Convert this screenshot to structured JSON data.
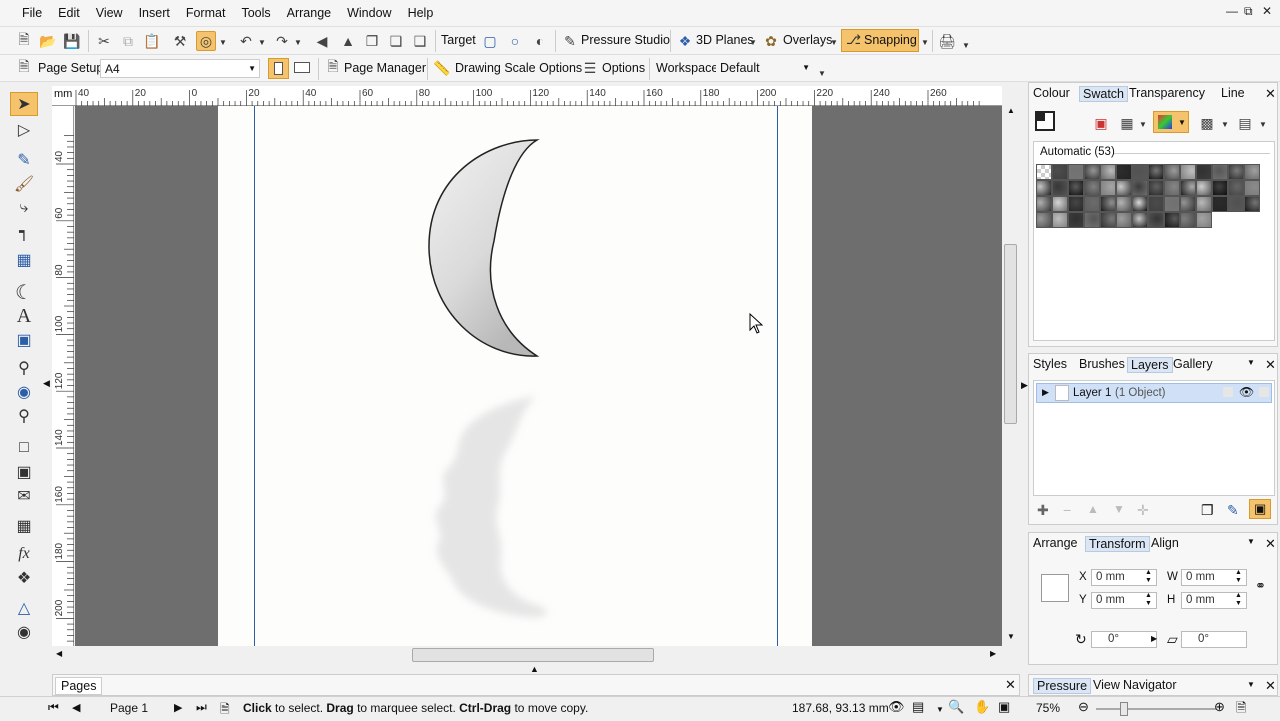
{
  "menu": [
    "File",
    "Edit",
    "View",
    "Insert",
    "Format",
    "Tools",
    "Arrange",
    "Window",
    "Help"
  ],
  "toolbar1": {
    "target_label": "Target",
    "pressure_label": "Pressure Studio",
    "planes_label": "3D Planes",
    "overlays_label": "Overlays",
    "snapping_label": "Snapping"
  },
  "toolbar2": {
    "page_setup_label": "Page Setup",
    "page_size_value": "A4",
    "page_manager_label": "Page Manager",
    "drawing_scale_label": "Drawing Scale Options",
    "options_label": "Options",
    "workspace_label": "Workspace",
    "workspace_value": "Default"
  },
  "ruler": {
    "unit": "mm",
    "h_ticks": [
      "40",
      "20",
      "0",
      "20",
      "40",
      "60",
      "80",
      "100",
      "120",
      "140",
      "160",
      "180",
      "200",
      "220",
      "240",
      "260"
    ],
    "v_ticks": [
      "40",
      "60",
      "80",
      "100",
      "120",
      "140",
      "160",
      "180",
      "200"
    ]
  },
  "colour_panel": {
    "tabs": [
      "Colour",
      "Swatch",
      "Transparency",
      "Line"
    ],
    "active_tab": "Swatch",
    "swatch_title": "Automatic (53)"
  },
  "layers_panel": {
    "tabs": [
      "Styles",
      "Brushes",
      "Layers",
      "Gallery"
    ],
    "active_tab": "Layers",
    "layer_name": "Layer 1",
    "layer_info": "(1 Object)"
  },
  "transform_panel": {
    "tabs": [
      "Arrange",
      "Transform",
      "Align"
    ],
    "active_tab": "Transform",
    "x_label": "X",
    "x_value": "0 mm",
    "y_label": "Y",
    "y_value": "0 mm",
    "w_label": "W",
    "w_value": "0 mm",
    "h_label": "H",
    "h_value": "0 mm",
    "rotate_value": "0°",
    "skew_value": "0°"
  },
  "pages_panel": {
    "title": "Pages"
  },
  "status": {
    "page_label": "Page 1",
    "hint_parts": [
      "Click",
      " to select. ",
      "Drag",
      " to marquee select. ",
      "Ctrl-Drag",
      " to move copy."
    ],
    "coords": "187.68, 93.13 mm",
    "zoom": "75%"
  },
  "bottom_right_tabs": [
    "Pressure",
    "View",
    "Navigator"
  ],
  "colors": {
    "accent": "#f5c36b",
    "selection": "#cfe0f7",
    "pasteboard": "#6e6e6e",
    "page": "#fdfdfc"
  }
}
